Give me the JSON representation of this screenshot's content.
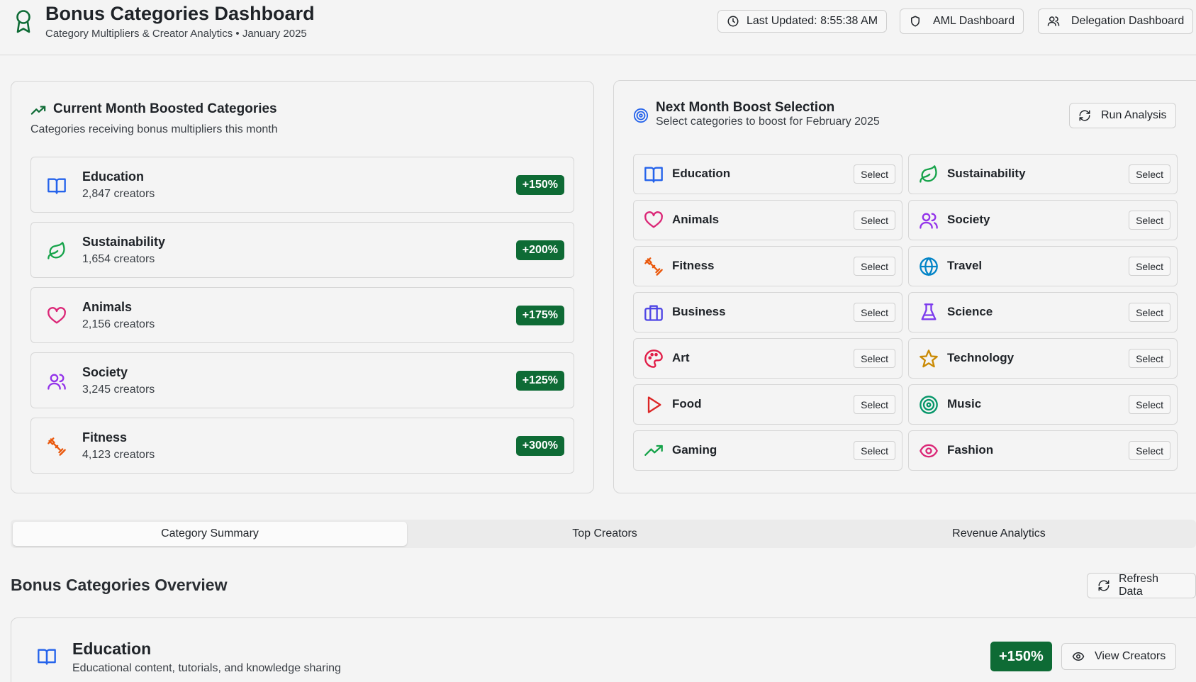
{
  "header": {
    "title": "Bonus Categories Dashboard",
    "subtitle": "Category Multipliers & Creator Analytics • January 2025",
    "last_updated": "Last Updated: 8:55:38 AM",
    "aml_label": "AML Dashboard",
    "delegation_label": "Delegation Dashboard",
    "logo_icon": "award-icon",
    "accent_color": "#0e6b35"
  },
  "current": {
    "title": "Current Month Boosted Categories",
    "description": "Categories receiving bonus multipliers this month",
    "items": [
      {
        "name": "Education",
        "count": "2,847 creators",
        "badge": "+150%",
        "icon": "book-icon"
      },
      {
        "name": "Sustainability",
        "count": "1,654 creators",
        "badge": "+200%",
        "icon": "leaf-icon"
      },
      {
        "name": "Animals",
        "count": "2,156 creators",
        "badge": "+175%",
        "icon": "heart-icon"
      },
      {
        "name": "Society",
        "count": "3,245 creators",
        "badge": "+125%",
        "icon": "users-icon"
      },
      {
        "name": "Fitness",
        "count": "4,123 creators",
        "badge": "+300%",
        "icon": "dumbbell-icon"
      }
    ]
  },
  "next": {
    "title": "Next Month Boost Selection",
    "description": "Select categories to boost for February 2025",
    "run_label": "Run Analysis",
    "select_label": "Select",
    "left": [
      {
        "name": "Education",
        "icon": "book-icon"
      },
      {
        "name": "Animals",
        "icon": "heart-icon"
      },
      {
        "name": "Fitness",
        "icon": "dumbbell-icon"
      },
      {
        "name": "Business",
        "icon": "briefcase-icon"
      },
      {
        "name": "Art",
        "icon": "palette-icon"
      },
      {
        "name": "Food",
        "icon": "play-icon"
      },
      {
        "name": "Gaming",
        "icon": "trending-up-icon"
      }
    ],
    "right": [
      {
        "name": "Sustainability",
        "icon": "leaf-icon"
      },
      {
        "name": "Society",
        "icon": "users-icon"
      },
      {
        "name": "Travel",
        "icon": "globe-icon"
      },
      {
        "name": "Science",
        "icon": "flask-icon"
      },
      {
        "name": "Technology",
        "icon": "star-icon"
      },
      {
        "name": "Music",
        "icon": "target-icon"
      },
      {
        "name": "Fashion",
        "icon": "eye-icon"
      }
    ]
  },
  "tabs": [
    "Category Summary",
    "Top Creators",
    "Revenue Analytics"
  ],
  "overview": {
    "title": "Bonus Categories Overview",
    "refresh_label": "Refresh Data",
    "card": {
      "name": "Education",
      "description": "Educational content, tutorials, and knowledge sharing",
      "badge": "+150%",
      "view_label": "View Creators"
    }
  }
}
